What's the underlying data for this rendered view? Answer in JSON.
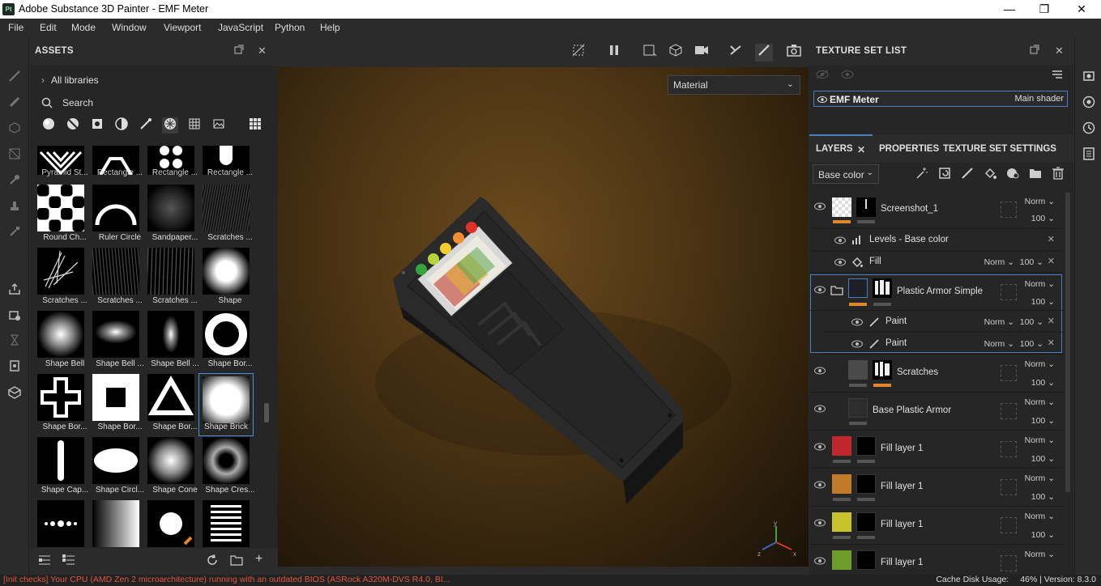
{
  "window": {
    "app_icon": "Pt",
    "title": "Adobe Substance 3D Painter - EMF Meter",
    "minimize": "—",
    "maximize": "❐",
    "close": "✕"
  },
  "menu": [
    "File",
    "Edit",
    "Mode",
    "Window",
    "Viewport",
    "JavaScript",
    "Python",
    "Help"
  ],
  "assets": {
    "title": "ASSETS",
    "breadcrumb": "All libraries",
    "search_placeholder": "Search",
    "tiles": [
      {
        "label": "Pyramid St...",
        "thumb": "pyramid"
      },
      {
        "label": "Rectangle ...",
        "thumb": "rect-arch"
      },
      {
        "label": "Rectangle ...",
        "thumb": "dots"
      },
      {
        "label": "Rectangle ...",
        "thumb": "rect-round"
      },
      {
        "label": "Round Ch...",
        "thumb": "checker"
      },
      {
        "label": "Ruler Circle",
        "thumb": "ruler-circle"
      },
      {
        "label": "Sandpaper...",
        "thumb": "noise"
      },
      {
        "label": "Scratches ...",
        "thumb": "noise2"
      },
      {
        "label": "Scratches ...",
        "thumb": "scratch1"
      },
      {
        "label": "Scratches ...",
        "thumb": "scratch2"
      },
      {
        "label": "Scratches ...",
        "thumb": "scratch3"
      },
      {
        "label": "Shape",
        "thumb": "shape"
      },
      {
        "label": "Shape Bell",
        "thumb": "bell"
      },
      {
        "label": "Shape Bell ...",
        "thumb": "bell2"
      },
      {
        "label": "Shape Bell ...",
        "thumb": "bell3"
      },
      {
        "label": "Shape Bor...",
        "thumb": "ring"
      },
      {
        "label": "Shape Bor...",
        "thumb": "cross"
      },
      {
        "label": "Shape Bor...",
        "thumb": "square-border"
      },
      {
        "label": "Shape Bor...",
        "thumb": "triangle"
      },
      {
        "label": "Shape Brick",
        "thumb": "brick"
      },
      {
        "label": "Shape Cap...",
        "thumb": "capsule"
      },
      {
        "label": "Shape Circl...",
        "thumb": "ellipse"
      },
      {
        "label": "Shape Cone",
        "thumb": "cone"
      },
      {
        "label": "Shape Cres...",
        "thumb": "crescent"
      },
      {
        "label": "",
        "thumb": "dots-line"
      },
      {
        "label": "",
        "thumb": "gradient"
      },
      {
        "label": "",
        "thumb": "circle"
      },
      {
        "label": "",
        "thumb": "stripes"
      }
    ]
  },
  "viewport": {
    "material_select": "Material"
  },
  "texture_set_list": {
    "title": "TEXTURE SET LIST",
    "item_name": "EMF Meter",
    "item_shader": "Main shader"
  },
  "layers": {
    "tabs": [
      "LAYERS",
      "PROPERTIES",
      "TEXTURE SET SETTINGS"
    ],
    "channel": "Base color",
    "rows": [
      {
        "name": "Screenshot_1",
        "blend": "Norm",
        "opacity": "100"
      },
      {
        "name": "Levels - Base color"
      },
      {
        "name": "Fill",
        "blend": "Norm",
        "opacity": "100"
      },
      {
        "name": "Plastic Armor Simple",
        "blend": "Norm",
        "opacity": "100"
      },
      {
        "name": "Paint",
        "blend": "Norm",
        "opacity": "100"
      },
      {
        "name": "Paint",
        "blend": "Norm",
        "opacity": "100"
      },
      {
        "name": "Scratches",
        "blend": "Norm",
        "opacity": "100"
      },
      {
        "name": "Base Plastic Armor",
        "blend": "Norm",
        "opacity": "100"
      },
      {
        "name": "Fill layer 1",
        "blend": "Norm",
        "opacity": "100",
        "color": "#c0272d"
      },
      {
        "name": "Fill layer 1",
        "blend": "Norm",
        "opacity": "100",
        "color": "#c07a2a"
      },
      {
        "name": "Fill layer 1",
        "blend": "Norm",
        "opacity": "100",
        "color": "#c8c22b"
      },
      {
        "name": "Fill layer 1",
        "blend": "Norm",
        "opacity": "",
        "color": "#6e9d2a"
      }
    ]
  },
  "status": {
    "warning": "[Init checks] Your CPU (AMD Zen 2 microarchitecture) running with an outdated BIOS (ASRock A320M-DVS R4.0, BI...",
    "cache": "Cache Disk Usage:",
    "cache_pct": "46%",
    "version": "| Version: 8.3.0"
  },
  "colors": {
    "accent": "#4a7ec0",
    "warning": "#e0563f",
    "mask_bar": "#e0882a"
  }
}
